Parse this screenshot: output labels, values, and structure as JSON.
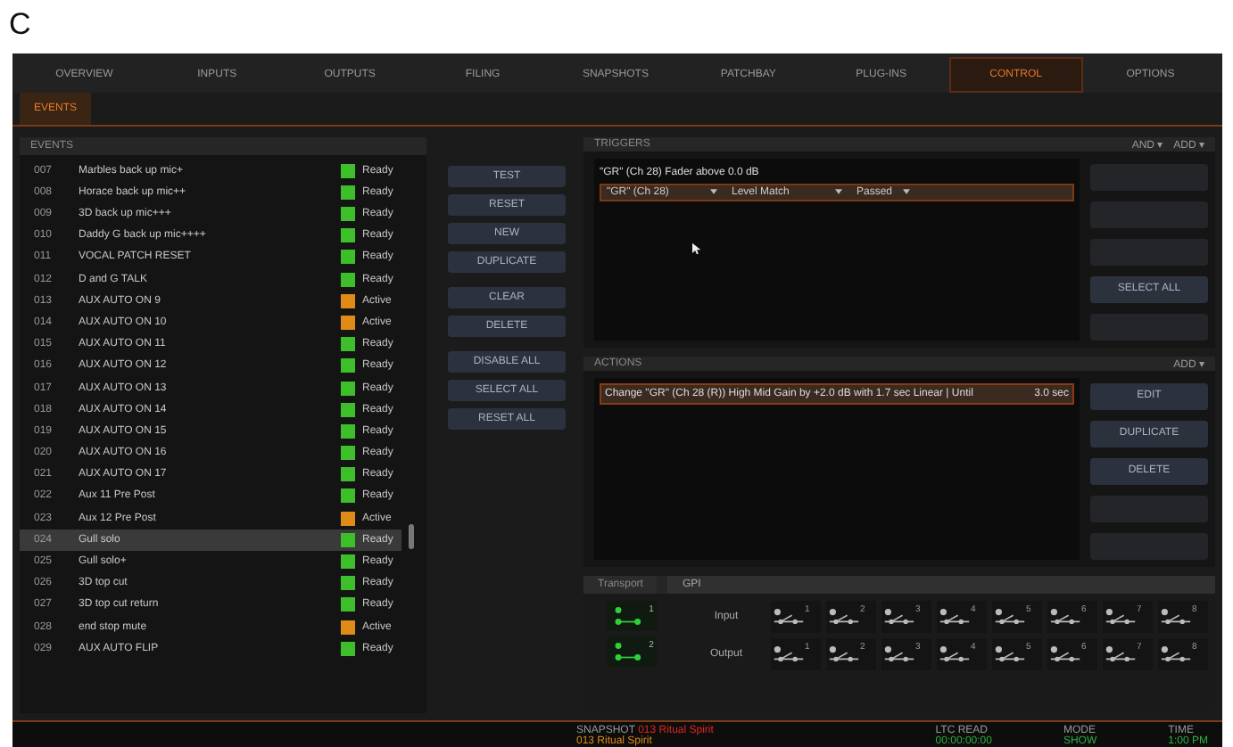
{
  "figure_label": "C",
  "nav_tabs": [
    {
      "label": "OVERVIEW",
      "selected": false
    },
    {
      "label": "INPUTS",
      "selected": false
    },
    {
      "label": "OUTPUTS",
      "selected": false
    },
    {
      "label": "FILING",
      "selected": false
    },
    {
      "label": "SNAPSHOTS",
      "selected": false
    },
    {
      "label": "PATCHBAY",
      "selected": false
    },
    {
      "label": "PLUG-INS",
      "selected": false
    },
    {
      "label": "CONTROL",
      "selected": true
    },
    {
      "label": "OPTIONS",
      "selected": false
    }
  ],
  "sub_tabs": [
    {
      "label": "EVENTS",
      "selected": true
    }
  ],
  "events": {
    "title": "EVENTS",
    "rows": [
      {
        "number": "007",
        "name": "Marbles back up mic+",
        "status": "Ready",
        "color": "#3cbf28",
        "selected": false
      },
      {
        "number": "008",
        "name": "Horace back up mic++",
        "status": "Ready",
        "color": "#3cbf28",
        "selected": false
      },
      {
        "number": "009",
        "name": "3D back up mic+++",
        "status": "Ready",
        "color": "#3cbf28",
        "selected": false
      },
      {
        "number": "010",
        "name": "Daddy G back up mic++++",
        "status": "Ready",
        "color": "#3cbf28",
        "selected": false
      },
      {
        "number": "011",
        "name": "VOCAL PATCH RESET",
        "status": "Ready",
        "color": "#3cbf28",
        "selected": false
      },
      {
        "number": "012",
        "name": "D and G TALK",
        "status": "Ready",
        "color": "#3cbf28",
        "selected": false
      },
      {
        "number": "013",
        "name": "AUX AUTO ON 9",
        "status": "Active",
        "color": "#e08a18",
        "selected": false
      },
      {
        "number": "014",
        "name": "AUX AUTO ON 10",
        "status": "Active",
        "color": "#e08a18",
        "selected": false
      },
      {
        "number": "015",
        "name": "AUX AUTO ON 11",
        "status": "Ready",
        "color": "#3cbf28",
        "selected": false
      },
      {
        "number": "016",
        "name": "AUX AUTO ON 12",
        "status": "Ready",
        "color": "#3cbf28",
        "selected": false
      },
      {
        "number": "017",
        "name": "AUX AUTO ON 13",
        "status": "Ready",
        "color": "#3cbf28",
        "selected": false
      },
      {
        "number": "018",
        "name": "AUX AUTO ON 14",
        "status": "Ready",
        "color": "#3cbf28",
        "selected": false
      },
      {
        "number": "019",
        "name": "AUX AUTO ON 15",
        "status": "Ready",
        "color": "#3cbf28",
        "selected": false
      },
      {
        "number": "020",
        "name": "AUX AUTO ON 16",
        "status": "Ready",
        "color": "#3cbf28",
        "selected": false
      },
      {
        "number": "021",
        "name": "AUX AUTO ON 17",
        "status": "Ready",
        "color": "#3cbf28",
        "selected": false
      },
      {
        "number": "022",
        "name": "Aux 11 Pre Post",
        "status": "Ready",
        "color": "#3cbf28",
        "selected": false
      },
      {
        "number": "023",
        "name": "Aux 12 Pre Post",
        "status": "Active",
        "color": "#e08a18",
        "selected": false
      },
      {
        "number": "024",
        "name": "Gull solo",
        "status": "Ready",
        "color": "#3cbf28",
        "selected": true
      },
      {
        "number": "025",
        "name": "Gull solo+",
        "status": "Ready",
        "color": "#3cbf28",
        "selected": false
      },
      {
        "number": "026",
        "name": "3D top cut",
        "status": "Ready",
        "color": "#3cbf28",
        "selected": false
      },
      {
        "number": "027",
        "name": "3D top cut return",
        "status": "Ready",
        "color": "#3cbf28",
        "selected": false
      },
      {
        "number": "028",
        "name": "end stop mute",
        "status": "Active",
        "color": "#e08a18",
        "selected": false
      },
      {
        "number": "029",
        "name": "AUX AUTO FLIP",
        "status": "Ready",
        "color": "#3cbf28",
        "selected": false
      }
    ]
  },
  "event_buttons": [
    {
      "label": "TEST"
    },
    {
      "label": "RESET"
    },
    {
      "label": "NEW"
    },
    {
      "label": "DUPLICATE"
    },
    {
      "label": "CLEAR"
    },
    {
      "label": "DELETE"
    },
    {
      "label": "DISABLE ALL"
    },
    {
      "label": "SELECT ALL"
    },
    {
      "label": "RESET ALL"
    }
  ],
  "triggers": {
    "title": "TRIGGERS",
    "logic": "AND ▾",
    "add": "ADD ▾",
    "condition": "\"GR\" (Ch 28) Fader above 0.0 dB",
    "selectors": [
      "\"GR\" (Ch 28)",
      "Level Match",
      "Passed"
    ],
    "side_buttons": [
      {
        "disabled": true
      },
      {
        "disabled": true
      },
      {
        "disabled": true
      },
      {
        "label": "SELECT ALL",
        "disabled": false
      },
      {
        "disabled": true
      }
    ]
  },
  "actions": {
    "title": "ACTIONS",
    "add": "ADD ▾",
    "items": [
      {
        "text": "Change \"GR\" (Ch 28 (R)) High Mid Gain by +2.0 dB with 1.7 sec Linear | Until",
        "delay": "3.0 sec",
        "selected": true
      }
    ],
    "side_buttons": [
      {
        "label": "EDIT",
        "disabled": false
      },
      {
        "label": "DUPLICATE",
        "disabled": false
      },
      {
        "label": "DELETE",
        "disabled": false
      },
      {
        "disabled": true
      },
      {
        "disabled": true
      }
    ]
  },
  "io": {
    "tabs": [
      {
        "label": "Transport",
        "selected": false
      },
      {
        "label": "GPI",
        "selected": true
      }
    ],
    "port_labels": [
      "1",
      "2"
    ],
    "rows": [
      {
        "label": "Input",
        "switches": [
          {
            "number": "1",
            "on": false
          },
          {
            "number": "2",
            "on": false
          },
          {
            "number": "3",
            "on": false
          },
          {
            "number": "4",
            "on": false
          },
          {
            "number": "5",
            "on": false
          },
          {
            "number": "6",
            "on": false
          },
          {
            "number": "7",
            "on": false
          },
          {
            "number": "8",
            "on": false
          }
        ]
      },
      {
        "label": "Output",
        "switches": [
          {
            "number": "1",
            "on": false
          },
          {
            "number": "2",
            "on": false
          },
          {
            "number": "3",
            "on": false
          },
          {
            "number": "4",
            "on": false
          },
          {
            "number": "5",
            "on": false
          },
          {
            "number": "6",
            "on": false
          },
          {
            "number": "7",
            "on": false
          },
          {
            "number": "8",
            "on": false
          }
        ]
      }
    ]
  },
  "status_bar": {
    "snapshot_label": "SNAPSHOT",
    "snapshot_current": "013 Ritual Spirit",
    "snapshot_next": "013 Ritual Spirit",
    "ltc_label": "LTC READ",
    "ltc_value": "00:00:00:00",
    "mode_label": "MODE",
    "mode_value": "SHOW",
    "time_label": "TIME",
    "time_value": "1:00 PM"
  }
}
